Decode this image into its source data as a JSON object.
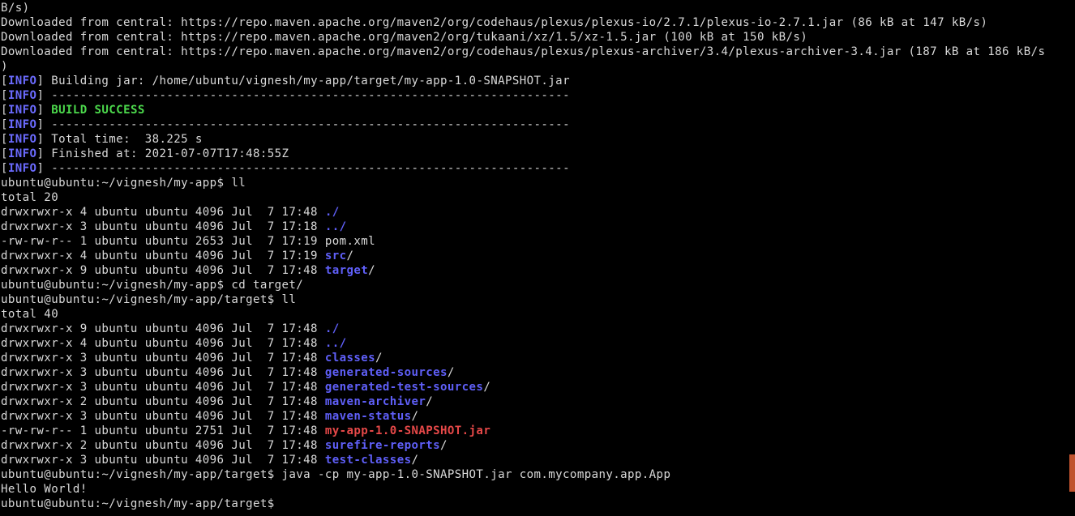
{
  "colors": {
    "background": "#000000",
    "text": "#d9d9d9",
    "directory": "#5f5ff8",
    "jar_file": "#e54848",
    "info_tag": "#6b6bff",
    "build_success": "#4cd94c",
    "scrollbar_thumb": "#c0532e"
  },
  "scrollbar": {
    "position_fraction": 0.95
  },
  "terminal": {
    "lines": [
      {
        "kind": "plain",
        "text": "B/s)"
      },
      {
        "kind": "plain",
        "text": "Downloaded from central: https://repo.maven.apache.org/maven2/org/codehaus/plexus/plexus-io/2.7.1/plexus-io-2.7.1.jar (86 kB at 147 kB/s)"
      },
      {
        "kind": "plain",
        "text": "Downloaded from central: https://repo.maven.apache.org/maven2/org/tukaani/xz/1.5/xz-1.5.jar (100 kB at 150 kB/s)"
      },
      {
        "kind": "plain",
        "text": "Downloaded from central: https://repo.maven.apache.org/maven2/org/codehaus/plexus/plexus-archiver/3.4/plexus-archiver-3.4.jar (187 kB at 186 kB/s"
      },
      {
        "kind": "plain",
        "text": ")"
      },
      {
        "kind": "info",
        "tag": "INFO",
        "text": "Building jar: /home/ubuntu/vignesh/my-app/target/my-app-1.0-SNAPSHOT.jar"
      },
      {
        "kind": "info",
        "tag": "INFO",
        "text": "------------------------------------------------------------------------"
      },
      {
        "kind": "info",
        "tag": "INFO",
        "text": "BUILD SUCCESS",
        "highlight": "success"
      },
      {
        "kind": "info",
        "tag": "INFO",
        "text": "------------------------------------------------------------------------"
      },
      {
        "kind": "info",
        "tag": "INFO",
        "text": "Total time:  38.225 s"
      },
      {
        "kind": "info",
        "tag": "INFO",
        "text": "Finished at: 2021-07-07T17:48:55Z"
      },
      {
        "kind": "info",
        "tag": "INFO",
        "text": "------------------------------------------------------------------------"
      },
      {
        "kind": "prompt",
        "prompt": "ubuntu@ubuntu:~/vignesh/my-app$",
        "command": "ll"
      },
      {
        "kind": "plain",
        "text": "total 20"
      },
      {
        "kind": "entry",
        "meta": "drwxrwxr-x 4 ubuntu ubuntu 4096 Jul  7 17:48",
        "name": "./",
        "style": "dir",
        "suffix": ""
      },
      {
        "kind": "entry",
        "meta": "drwxrwxr-x 3 ubuntu ubuntu 4096 Jul  7 17:18",
        "name": "../",
        "style": "dir",
        "suffix": ""
      },
      {
        "kind": "entry",
        "meta": "-rw-rw-r-- 1 ubuntu ubuntu 2653 Jul  7 17:19",
        "name": "pom.xml",
        "style": "file",
        "suffix": ""
      },
      {
        "kind": "entry",
        "meta": "drwxrwxr-x 4 ubuntu ubuntu 4096 Jul  7 17:19",
        "name": "src",
        "style": "dir",
        "suffix": "/"
      },
      {
        "kind": "entry",
        "meta": "drwxrwxr-x 9 ubuntu ubuntu 4096 Jul  7 17:48",
        "name": "target",
        "style": "dir",
        "suffix": "/"
      },
      {
        "kind": "prompt",
        "prompt": "ubuntu@ubuntu:~/vignesh/my-app$",
        "command": "cd target/"
      },
      {
        "kind": "prompt",
        "prompt": "ubuntu@ubuntu:~/vignesh/my-app/target$",
        "command": "ll"
      },
      {
        "kind": "plain",
        "text": "total 40"
      },
      {
        "kind": "entry",
        "meta": "drwxrwxr-x 9 ubuntu ubuntu 4096 Jul  7 17:48",
        "name": "./",
        "style": "dir",
        "suffix": ""
      },
      {
        "kind": "entry",
        "meta": "drwxrwxr-x 4 ubuntu ubuntu 4096 Jul  7 17:48",
        "name": "../",
        "style": "dir",
        "suffix": ""
      },
      {
        "kind": "entry",
        "meta": "drwxrwxr-x 3 ubuntu ubuntu 4096 Jul  7 17:48",
        "name": "classes",
        "style": "dir",
        "suffix": "/"
      },
      {
        "kind": "entry",
        "meta": "drwxrwxr-x 3 ubuntu ubuntu 4096 Jul  7 17:48",
        "name": "generated-sources",
        "style": "dir",
        "suffix": "/"
      },
      {
        "kind": "entry",
        "meta": "drwxrwxr-x 3 ubuntu ubuntu 4096 Jul  7 17:48",
        "name": "generated-test-sources",
        "style": "dir",
        "suffix": "/"
      },
      {
        "kind": "entry",
        "meta": "drwxrwxr-x 2 ubuntu ubuntu 4096 Jul  7 17:48",
        "name": "maven-archiver",
        "style": "dir",
        "suffix": "/"
      },
      {
        "kind": "entry",
        "meta": "drwxrwxr-x 3 ubuntu ubuntu 4096 Jul  7 17:48",
        "name": "maven-status",
        "style": "dir",
        "suffix": "/"
      },
      {
        "kind": "entry",
        "meta": "-rw-rw-r-- 1 ubuntu ubuntu 2751 Jul  7 17:48",
        "name": "my-app-1.0-SNAPSHOT.jar",
        "style": "jar",
        "suffix": ""
      },
      {
        "kind": "entry",
        "meta": "drwxrwxr-x 2 ubuntu ubuntu 4096 Jul  7 17:48",
        "name": "surefire-reports",
        "style": "dir",
        "suffix": "/"
      },
      {
        "kind": "entry",
        "meta": "drwxrwxr-x 3 ubuntu ubuntu 4096 Jul  7 17:48",
        "name": "test-classes",
        "style": "dir",
        "suffix": "/"
      },
      {
        "kind": "prompt",
        "prompt": "ubuntu@ubuntu:~/vignesh/my-app/target$",
        "command": "java -cp my-app-1.0-SNAPSHOT.jar com.mycompany.app.App"
      },
      {
        "kind": "plain",
        "text": "Hello World!"
      },
      {
        "kind": "prompt",
        "prompt": "ubuntu@ubuntu:~/vignesh/my-app/target$",
        "command": ""
      }
    ]
  }
}
